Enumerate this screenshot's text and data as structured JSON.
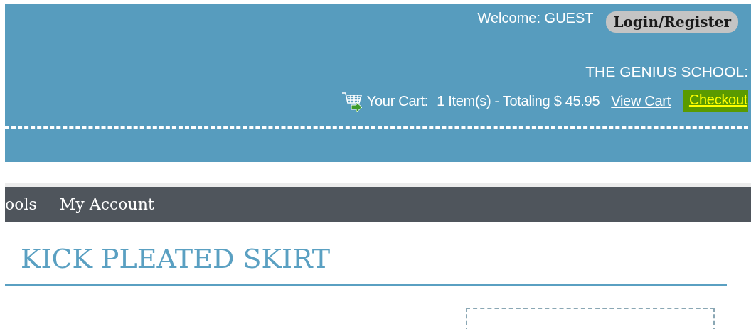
{
  "header": {
    "welcome": "Welcome: GUEST",
    "login_button": "Login/Register",
    "school": "THE GENIUS SCHOOL:",
    "cart": {
      "label": "Your Cart:",
      "summary": "1 Item(s) - Totaling $ 45.95",
      "view_link": "View Cart",
      "checkout_link": "Checkout"
    }
  },
  "nav": {
    "items": [
      {
        "label": "ools"
      },
      {
        "label": "My Account"
      }
    ]
  },
  "product": {
    "title": "KICK PLEATED SKIRT"
  }
}
